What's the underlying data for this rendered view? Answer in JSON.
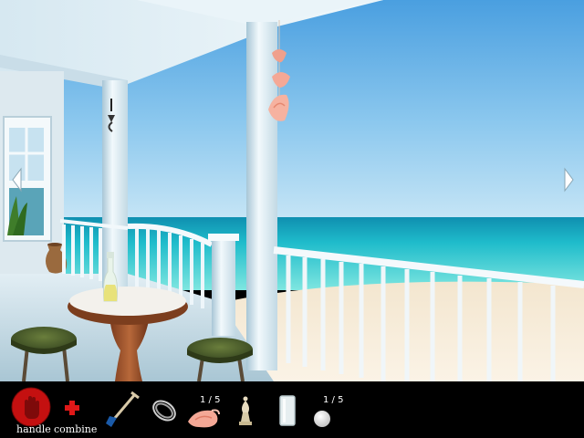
{
  "toolbar": {
    "handle_label": "handle",
    "combine_label": "combine",
    "shell_count": "1 / 5",
    "pearl_count": "1 / 5"
  },
  "colors": {
    "sky_top": "#4a9fe0",
    "sea": "#1fc4cf",
    "porch_white": "#e6f2f8",
    "handle_red": "#c41010",
    "combine_red": "#e01818",
    "stool_green": "#46592a"
  },
  "icons": {
    "handle": "hand-icon",
    "combine": "plus-icon",
    "nav_left": "arrow-left-icon",
    "nav_right": "arrow-right-icon"
  },
  "inventory": [
    "shovel",
    "rope",
    "shell",
    "chess-bishop",
    "glass",
    "pearl"
  ]
}
